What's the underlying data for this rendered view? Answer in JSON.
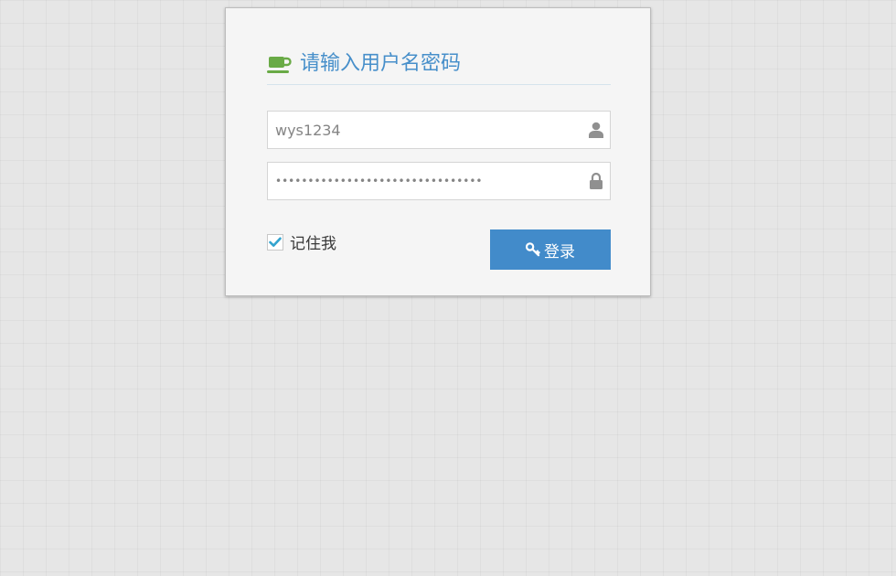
{
  "login": {
    "title": "请输入用户名密码",
    "username_value": "wys1234",
    "password_value": "••••••••••••••••••••••••••••••••",
    "remember_label": "记住我",
    "remember_checked": true,
    "submit_label": "登录"
  },
  "colors": {
    "accent": "#478fca",
    "button": "#428bca",
    "cup_icon": "#69aa46",
    "input_icon": "#909090"
  },
  "icons": {
    "title_icon": "coffee-cup-icon",
    "username_icon": "user-icon",
    "password_icon": "lock-icon",
    "checkbox_mark": "check-icon",
    "button_icon": "key-icon"
  }
}
